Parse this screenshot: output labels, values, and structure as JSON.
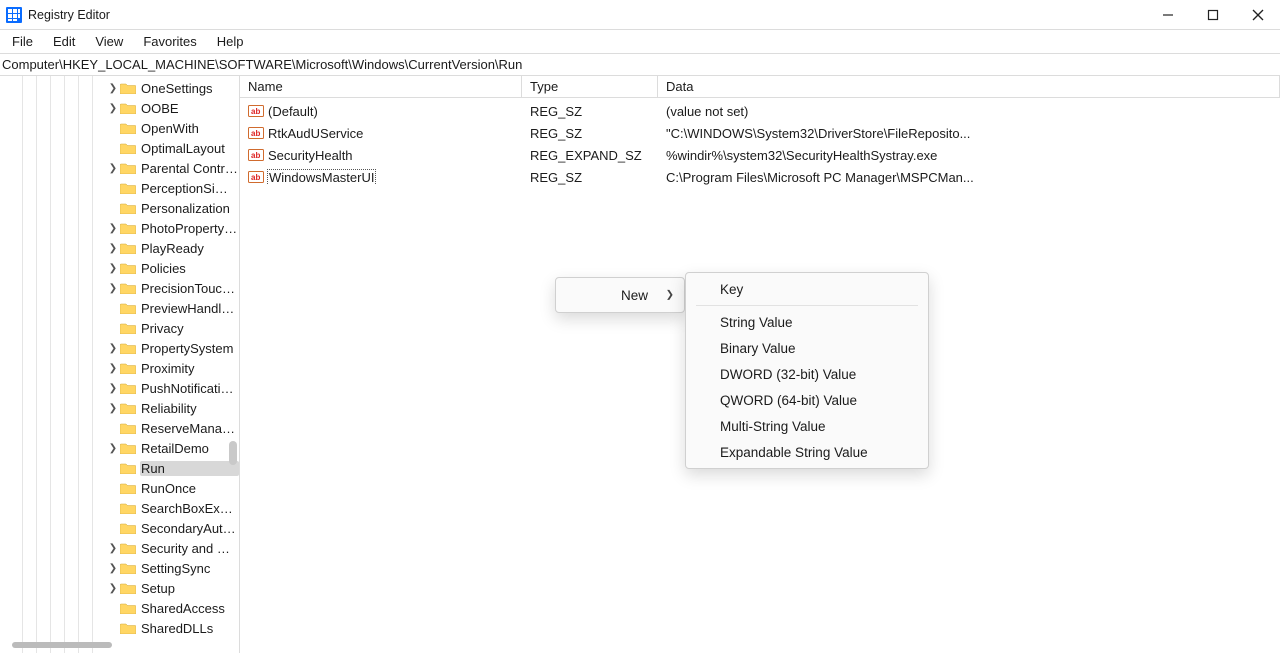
{
  "window": {
    "title": "Registry Editor"
  },
  "menu": {
    "file": "File",
    "edit": "Edit",
    "view": "View",
    "favorites": "Favorites",
    "help": "Help"
  },
  "address": "Computer\\HKEY_LOCAL_MACHINE\\SOFTWARE\\Microsoft\\Windows\\CurrentVersion\\Run",
  "tree": [
    {
      "label": "OneSettings",
      "expandable": true
    },
    {
      "label": "OOBE",
      "expandable": true
    },
    {
      "label": "OpenWith",
      "expandable": false
    },
    {
      "label": "OptimalLayout",
      "expandable": false
    },
    {
      "label": "Parental Controls",
      "expandable": true
    },
    {
      "label": "PerceptionSimulation",
      "expandable": false
    },
    {
      "label": "Personalization",
      "expandable": false
    },
    {
      "label": "PhotoPropertyHandler",
      "expandable": true
    },
    {
      "label": "PlayReady",
      "expandable": true
    },
    {
      "label": "Policies",
      "expandable": true
    },
    {
      "label": "PrecisionTouchpad",
      "expandable": true
    },
    {
      "label": "PreviewHandlers",
      "expandable": false
    },
    {
      "label": "Privacy",
      "expandable": false
    },
    {
      "label": "PropertySystem",
      "expandable": true
    },
    {
      "label": "Proximity",
      "expandable": true
    },
    {
      "label": "PushNotifications",
      "expandable": true
    },
    {
      "label": "Reliability",
      "expandable": true
    },
    {
      "label": "ReserveManager",
      "expandable": false
    },
    {
      "label": "RetailDemo",
      "expandable": true
    },
    {
      "label": "Run",
      "expandable": false,
      "selected": true
    },
    {
      "label": "RunOnce",
      "expandable": false
    },
    {
      "label": "SearchBoxExperimentalFeatures",
      "expandable": false
    },
    {
      "label": "SecondaryAuthFactor",
      "expandable": false
    },
    {
      "label": "Security and Maintenance",
      "expandable": true
    },
    {
      "label": "SettingSync",
      "expandable": true
    },
    {
      "label": "Setup",
      "expandable": true
    },
    {
      "label": "SharedAccess",
      "expandable": false
    },
    {
      "label": "SharedDLLs",
      "expandable": false
    }
  ],
  "list": {
    "columns": {
      "name": "Name",
      "type": "Type",
      "data": "Data"
    },
    "rows": [
      {
        "name": "(Default)",
        "type": "REG_SZ",
        "data": "(value not set)"
      },
      {
        "name": "RtkAudUService",
        "type": "REG_SZ",
        "data": "\"C:\\WINDOWS\\System32\\DriverStore\\FileReposito..."
      },
      {
        "name": "SecurityHealth",
        "type": "REG_EXPAND_SZ",
        "data": "%windir%\\system32\\SecurityHealthSystray.exe"
      },
      {
        "name": "WindowsMasterUI",
        "type": "REG_SZ",
        "data": "C:\\Program Files\\Microsoft PC Manager\\MSPCMan...",
        "selected": true
      }
    ]
  },
  "ctx_new": "New",
  "ctx_sub": {
    "key": "Key",
    "string": "String Value",
    "binary": "Binary Value",
    "dword": "DWORD (32-bit) Value",
    "qword": "QWORD (64-bit) Value",
    "multi": "Multi-String Value",
    "expand": "Expandable String Value"
  }
}
